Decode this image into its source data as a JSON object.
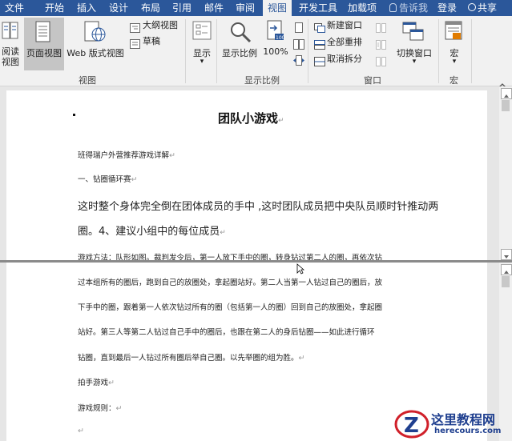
{
  "tabs": [
    "文件",
    "开始",
    "插入",
    "设计",
    "布局",
    "引用",
    "邮件",
    "审阅",
    "视图",
    "开发工具",
    "加载项"
  ],
  "active_tab": "视图",
  "tell_me": "告诉我",
  "login": "登录",
  "share": "共享",
  "ribbon": {
    "views": {
      "read_mode": "阅读\n视图",
      "print_layout": "页面视图",
      "web_layout": "Web 版式视图",
      "outline": "大纲视图",
      "draft": "草稿",
      "group_label": "视图"
    },
    "show": {
      "button": "显示",
      "arrow": "▾"
    },
    "zoom": {
      "zoom_button": "显示比例",
      "hundred": "100%",
      "group_label": "显示比例"
    },
    "window": {
      "new_window": "新建窗口",
      "arrange_all": "全部重排",
      "remove_split": "取消拆分",
      "switch_windows": "切换窗口",
      "group_label": "窗口"
    },
    "macros": {
      "button": "宏",
      "group_label": "宏"
    }
  },
  "document": {
    "title": "团队小游戏",
    "top_lines": [
      "班得瑞户外营推荐游戏详解",
      "一、钻圈循环赛",
      "这时整个身体完全倒在团体成员的手中 ,这时团队成员把中央队员顺时针推动两",
      "圈。4、建议小组中的每位成员",
      "游戏方法：队形如图。裁判发令后，第一人放下手中的圈，转身钻过第二人的圈，再依次钻"
    ],
    "bottom_lines": [
      "过本组所有的圈后，跑到自己的放圈处，拿起圈站好。第二人当第一人钻过自己的圈后，放",
      "下手中的圈，跟着第一人依次钻过所有的圈（包括第一人的圈）回到自己的放圈处，拿起圈",
      "站好。第三人等第二人钻过自己手中的圈后，也跟在第二人的身后钻圈——如此进行循环",
      "钻圈，直到最后一人钻过所有圈后举自己圈。以先举圈的组为胜。",
      "拍手游戏",
      "游戏规则："
    ],
    "para_mark": "↵"
  },
  "watermark": {
    "title": "这里教程网",
    "url": "herecours.com"
  }
}
